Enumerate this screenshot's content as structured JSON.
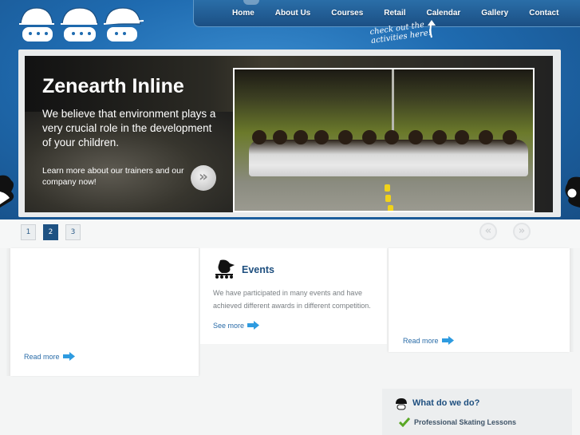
{
  "nav": {
    "items": [
      "Home",
      "About Us",
      "Courses",
      "Retail",
      "Calendar",
      "Gallery",
      "Contact"
    ],
    "callout": "check out the activities here!"
  },
  "slide": {
    "title": "Zenearth Inline",
    "text": "We believe that environment plays a very crucial role in the development of your children.",
    "link_text": "Learn more about our trainers and our company now!",
    "more_button": "»"
  },
  "pager": {
    "pages": [
      "1",
      "2",
      "3"
    ],
    "active_page": "2",
    "prev": "«",
    "next": "»"
  },
  "columns": {
    "left_more": "Read more",
    "events": {
      "title": "Events",
      "text": "We have participated in many events and have achieved different awards in different competition.",
      "more": "See more"
    },
    "right_more": "Read more"
  },
  "what": {
    "title": "What do we do?",
    "items": [
      "Professional Skating Lessons"
    ]
  },
  "colors": {
    "header_blue": "#1f6bb0",
    "link_blue": "#2a6ca8",
    "heading_navy": "#1e4f7f",
    "arrow_blue": "#2e9be0",
    "check_green": "#5aa826"
  },
  "icons": [
    "helmet-logo",
    "skater-icon",
    "arrow-right-icon",
    "check-icon",
    "helmet-icon"
  ]
}
